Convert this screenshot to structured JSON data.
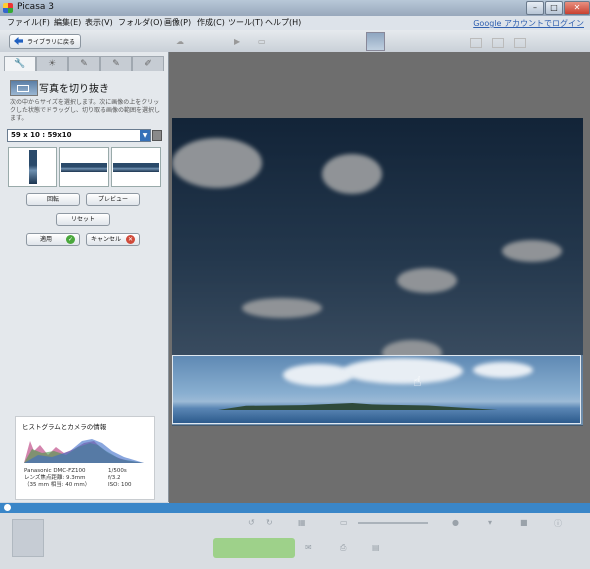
{
  "window": {
    "title": "Picasa 3"
  },
  "menubar": {
    "items": [
      "ファイル(F)",
      "編集(E)",
      "表示(V)",
      "フォルダ(O)",
      "画像(P)",
      "作成(C)",
      "ツール(T)",
      "ヘルプ(H)"
    ],
    "account_link": "Google アカウントでログイン"
  },
  "toolbar": {
    "back_label": "ライブラリに戻る"
  },
  "sidebar": {
    "panel_title": "写真を切り抜き",
    "instructions": "次の中からサイズを選択します。次に画像の上をクリックした状態でドラッグし、切り取る画像の範囲を選択します。",
    "size_select": {
      "value": "59 x 10 : 59x10"
    },
    "buttons": {
      "rotate": "回転",
      "preview": "プレビュー",
      "reset": "リセット",
      "apply": "適用",
      "cancel": "キャンセル"
    },
    "histogram": {
      "title": "ヒストグラムとカメラの情報",
      "camera": "Panasonic DMC-FZ100",
      "focal": "レンズ焦点距離: 9.3mm",
      "equiv": "（35 mm 相当: 40 mm）",
      "shutter": "1/500s",
      "aperture": "f/3.2",
      "iso": "ISO: 100"
    }
  },
  "colors": {
    "accent": "#3a86c8",
    "apply_icon": "#4aa83c",
    "cancel_icon": "#d04a3a"
  },
  "icons": [
    "back-arrow-icon",
    "wrench-icon",
    "brush-icon",
    "pencil-icon",
    "crop-icon",
    "trash-icon",
    "check-icon",
    "x-icon",
    "hand-cursor-icon"
  ]
}
